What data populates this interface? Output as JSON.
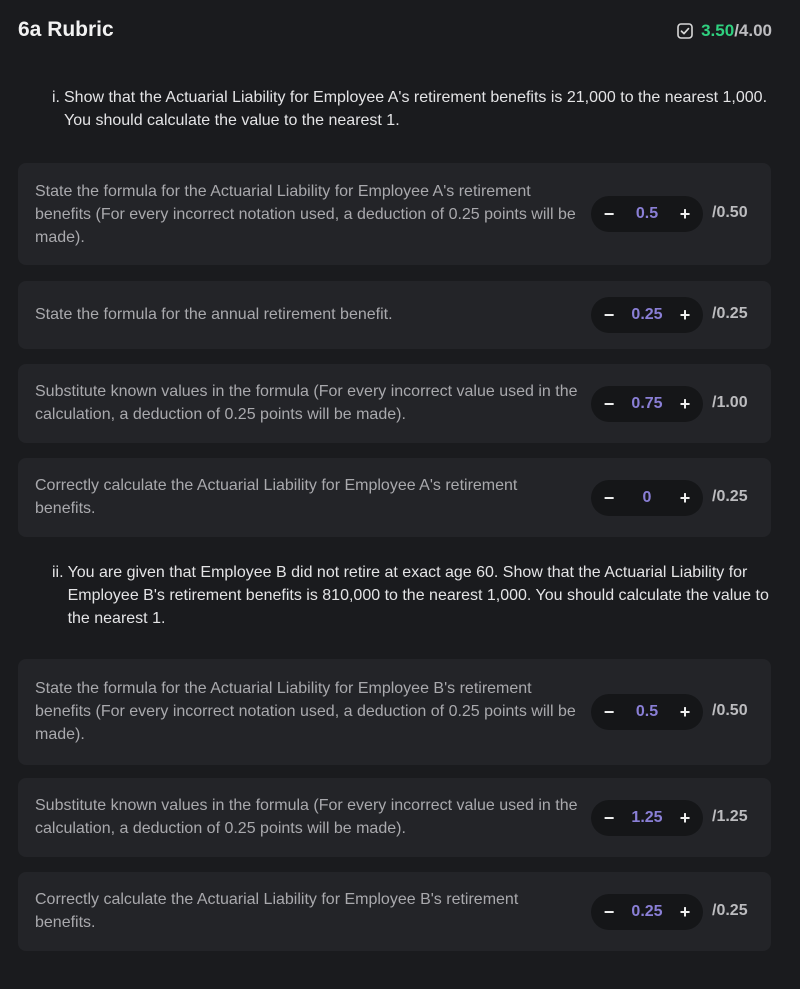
{
  "header": {
    "title": "6a Rubric",
    "score_earned": "3.50",
    "score_total": "/4.00"
  },
  "sections": [
    {
      "number": "i.",
      "text": "Show that the Actuarial Liability for Employee A's retirement benefits is 21,000 to the nearest 1,000. You should calculate the value to the nearest 1.",
      "criteria": [
        {
          "text": "State the formula for the Actuarial Liability for Employee A's retirement benefits (For every incorrect notation used, a deduction of 0.25 points will be made).",
          "value": "0.5",
          "max": "/0.50"
        },
        {
          "text": "State the formula for the annual retirement benefit.",
          "value": "0.25",
          "max": "/0.25"
        },
        {
          "text": "Substitute known values in the formula (For every incorrect value used in the calculation, a deduction of 0.25 points will be made).",
          "value": "0.75",
          "max": "/1.00"
        },
        {
          "text": "Correctly calculate the Actuarial Liability for Employee A's retirement benefits.",
          "value": "0",
          "max": "/0.25"
        }
      ]
    },
    {
      "number": "ii.",
      "text": "You are given that Employee B did not retire at exact age 60. Show that the Actuarial Liability for Employee B's retirement benefits is 810,000 to the nearest 1,000. You should calculate the value to the nearest 1.",
      "criteria": [
        {
          "text": "State the formula for the Actuarial Liability for Employee B's retirement benefits (For every incorrect notation used, a deduction of 0.25 points will be made).",
          "value": "0.5",
          "max": "/0.50"
        },
        {
          "text": "Substitute known values in the formula (For every incorrect value used in the calculation, a deduction of 0.25 points will be made).",
          "value": "1.25",
          "max": "/1.25"
        },
        {
          "text": "Correctly calculate the Actuarial Liability for Employee B's retirement benefits.",
          "value": "0.25",
          "max": "/0.25"
        }
      ]
    }
  ],
  "stepper": {
    "minus_label": "−",
    "plus_label": "+"
  },
  "colors": {
    "background": "#1a1b1e",
    "card": "#232428",
    "earned_score": "#2fd07f",
    "value_accent": "#8a7fd6"
  }
}
